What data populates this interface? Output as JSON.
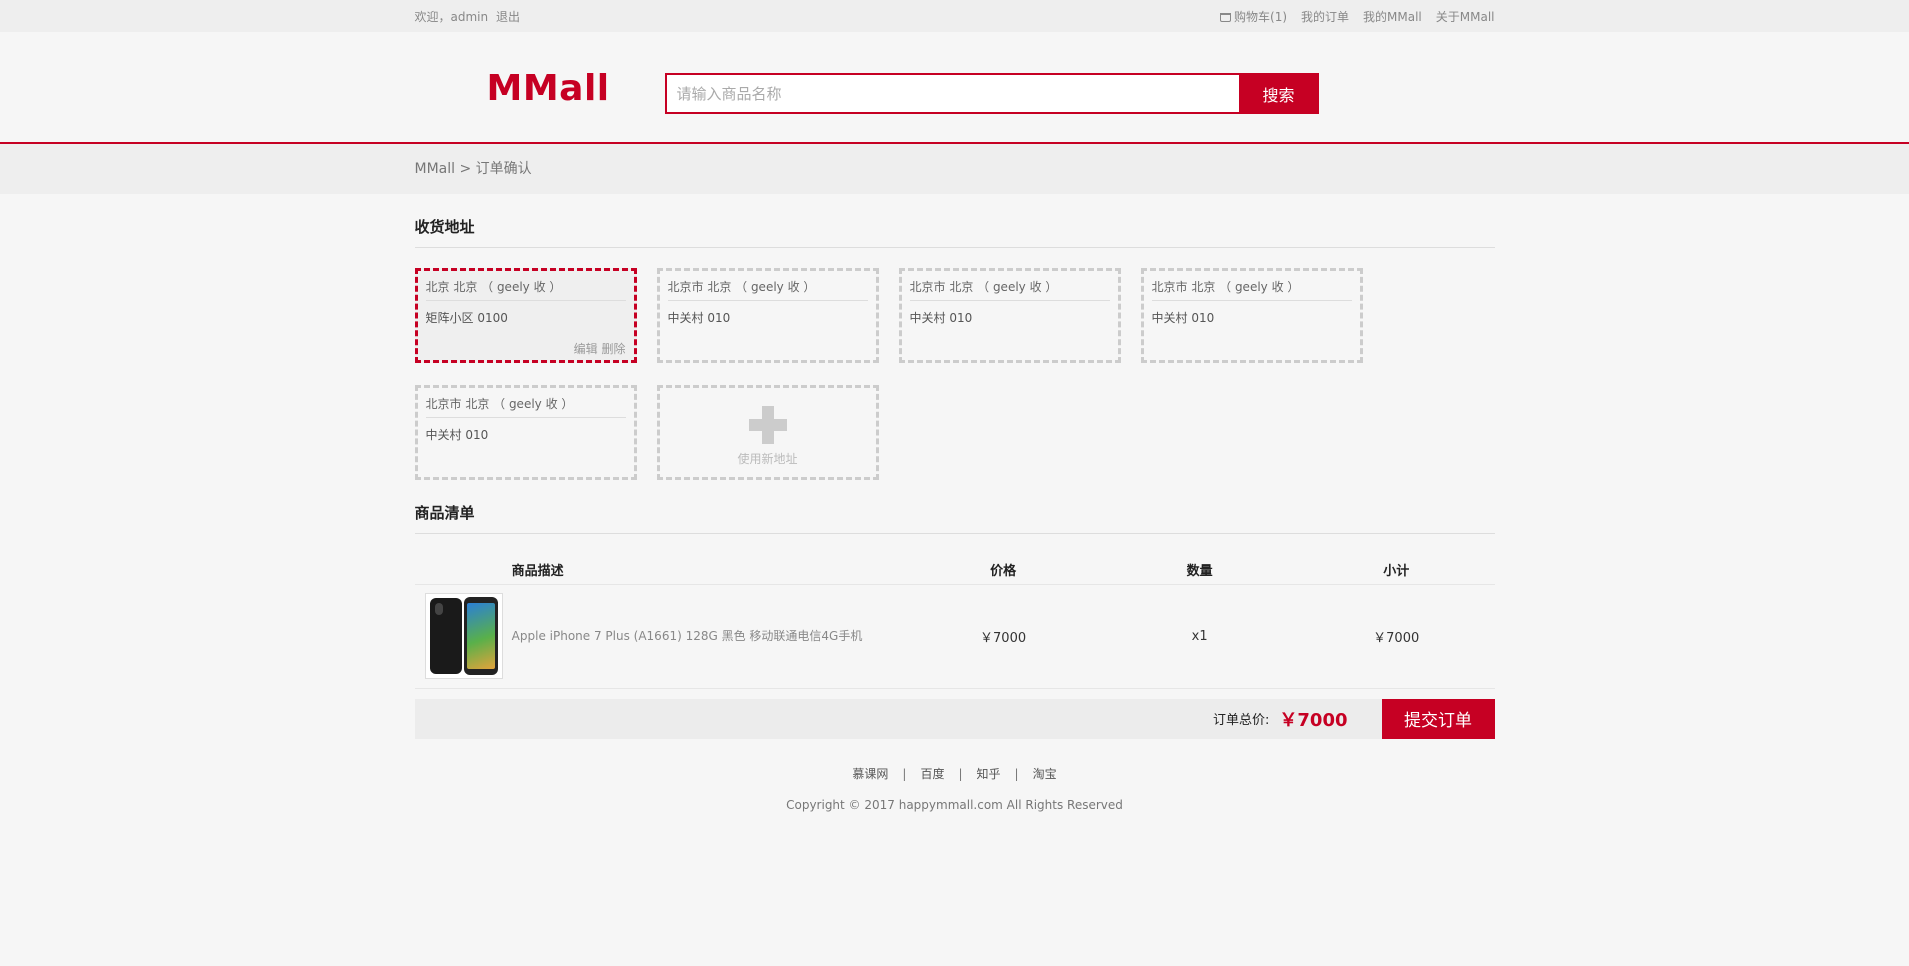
{
  "topnav": {
    "welcome": "欢迎，admin",
    "logout": "退出",
    "cart": "购物车(1)",
    "orders": "我的订单",
    "my_mall": "我的MMall",
    "about": "关于MMall"
  },
  "header": {
    "logo": "MMall",
    "search_placeholder": "请输入商品名称",
    "search_button": "搜索"
  },
  "breadcrumb": "MMall > 订单确认",
  "addresses": {
    "title": "收货地址",
    "items": [
      {
        "name": "北京 北京 （ geely 收 ）",
        "detail": "矩阵小区 0100",
        "edit": "编辑",
        "delete": "删除"
      },
      {
        "name": "北京市 北京 （ geely 收 ）",
        "detail": "中关村 010"
      },
      {
        "name": "北京市 北京 （ geely 收 ）",
        "detail": "中关村 010"
      },
      {
        "name": "北京市 北京 （ geely 收 ）",
        "detail": "中关村 010"
      },
      {
        "name": "北京市 北京 （ geely 收 ）",
        "detail": "中关村 010"
      }
    ],
    "new_label": "使用新地址"
  },
  "products": {
    "title": "商品清单",
    "headers": [
      "商品描述",
      "价格",
      "数量",
      "小计"
    ],
    "rows": [
      {
        "desc": "Apple iPhone 7 Plus (A1661) 128G 黑色 移动联通电信4G手机",
        "price": "￥7000",
        "qty": "x1",
        "subtotal": "￥7000"
      }
    ]
  },
  "summary": {
    "label": "订单总价:",
    "total": "￥7000",
    "submit": "提交订单"
  },
  "footer": {
    "links": [
      "慕课网",
      "百度",
      "知乎",
      "淘宝"
    ],
    "separator": "|",
    "copyright": "Copyright © 2017 happymmall.com All Rights Reserved"
  },
  "colors": {
    "brand": "#c60023",
    "background": "#f6f6f6"
  }
}
